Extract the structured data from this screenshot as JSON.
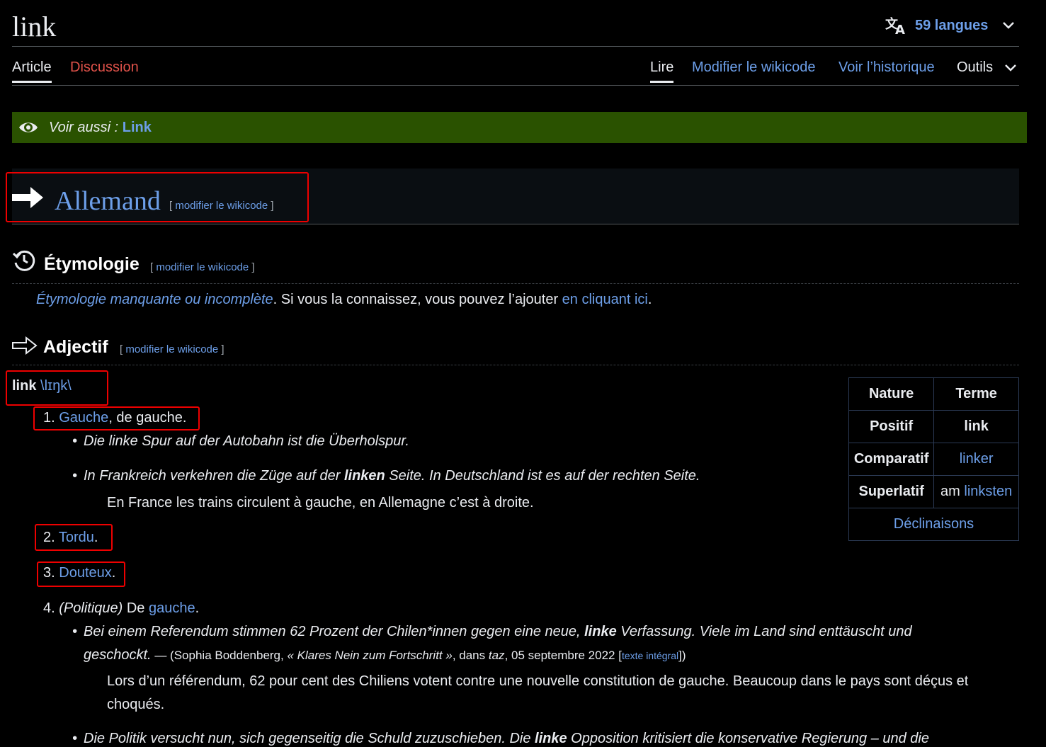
{
  "page": {
    "title": "link"
  },
  "languages": {
    "label": "59 langues"
  },
  "tabs": {
    "article": "Article",
    "discussion": "Discussion",
    "read": "Lire",
    "edit": "Modifier le wikicode",
    "history": "Voir l’historique",
    "tools": "Outils"
  },
  "see_also": {
    "label": "Voir aussi :",
    "link": "Link"
  },
  "edit_link": {
    "open": "[",
    "text": "modifier le wikicode",
    "close": "]"
  },
  "sections": {
    "language": "Allemand",
    "etymology": "Étymologie",
    "pos": "Adjectif"
  },
  "etymology": {
    "link1": "Étymologie manquante ou incomplète",
    "text": ". Si vous la connaissez, vous pouvez l’ajouter ",
    "link2": "en cliquant ici",
    "end": "."
  },
  "headword": {
    "word": "link",
    "pron": "\\lɪŋk\\"
  },
  "definitions": [
    {
      "num": "1.",
      "link": "Gauche",
      "rest": ", de gauche."
    },
    {
      "num": "2.",
      "link": "Tordu",
      "rest": "."
    },
    {
      "num": "3.",
      "link": "Douteux",
      "rest": "."
    },
    {
      "num": "4.",
      "pre": "(Politique)",
      "mid": " De ",
      "link": "gauche",
      "rest": "."
    }
  ],
  "examples": {
    "ex1": "Die linke Spur auf der Autobahn ist die Überholspur.",
    "ex2_a": "In Frankreich verkehren die Züge auf der ",
    "ex2_b": "linken",
    "ex2_c": " Seite. In Deutschland ist es auf der rechten Seite.",
    "ex2_tr": "En France les trains circulent à gauche, en Allemagne c’est à droite.",
    "ex3_a": "Bei einem Referendum stimmen 62 Prozent der Chilen*innen gegen eine neue, ",
    "ex3_b": "linke",
    "ex3_c": " Verfassung. Viele im Land sind enttäuscht und",
    "ex3_d": "geschockt.",
    "ex3_src_a": " — (Sophia Boddenberg, ",
    "ex3_src_title": "« Klares Nein zum Fortschritt »",
    "ex3_src_b": ", dans ",
    "ex3_src_pub": "taz",
    "ex3_src_c": ", 05 septembre 2022 [",
    "ex3_src_link": "texte intégral",
    "ex3_src_d": "])",
    "ex3_tr1": "Lors d’un référendum, 62 pour cent des Chiliens votent contre une nouvelle constitution de gauche. Beaucoup dans le pays sont déçus et",
    "ex3_tr2": "choqués.",
    "ex4_a": "Die Politik versucht nun, sich gegenseitig die Schuld zuzuschieben. Die ",
    "ex4_b": "linke",
    "ex4_c": " Opposition kritisiert die konservative Regierung – und die"
  },
  "flex_table": {
    "h1": "Nature",
    "h2": "Terme",
    "r1a": "Positif",
    "r1b": "link",
    "r2a": "Comparatif",
    "r2b": "linker",
    "r3a": "Superlatif",
    "r3b_pre": "am ",
    "r3b_link": "linksten",
    "footer": "Déclinaisons"
  },
  "colors": {
    "link": "#6d9fe9",
    "discussion": "#e0524a",
    "banner": "#2a5200",
    "highlight_box": "#e00000"
  }
}
